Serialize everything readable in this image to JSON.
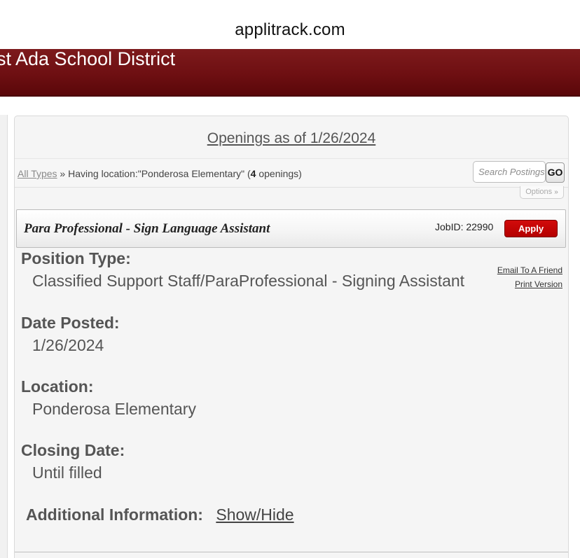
{
  "browser": {
    "url": "applitrack.com"
  },
  "header": {
    "district_name": "st Ada School District"
  },
  "openings": {
    "title": "Openings as of 1/26/2024"
  },
  "filter": {
    "all_types_link": "All Types",
    "separator": " » ",
    "location_text": "Having location:\"Ponderosa Elementary\" (",
    "count": "4",
    "count_suffix": " openings)",
    "search_placeholder": "Search Postings",
    "go_label": "GO",
    "options_label": "Options"
  },
  "job": {
    "title": "Para Professional - Sign Language Assistant",
    "jobid_text": "JobID: 22990",
    "apply_label": "Apply",
    "email_link": "Email To A Friend",
    "print_link": "Print Version",
    "position_type_label": "Position Type:",
    "position_type_value": "Classified Support Staff/ParaProfessional - Signing Assistant",
    "date_posted_label": "Date Posted:",
    "date_posted_value": "1/26/2024",
    "location_label": "Location:",
    "location_value": "Ponderosa Elementary",
    "closing_date_label": "Closing Date:",
    "closing_date_value": "Until filled",
    "additional_info_label": "Additional Information:",
    "show_hide_label": "Show/Hide"
  },
  "colors": {
    "brand": "#6e0f12",
    "apply": "#c40000"
  }
}
